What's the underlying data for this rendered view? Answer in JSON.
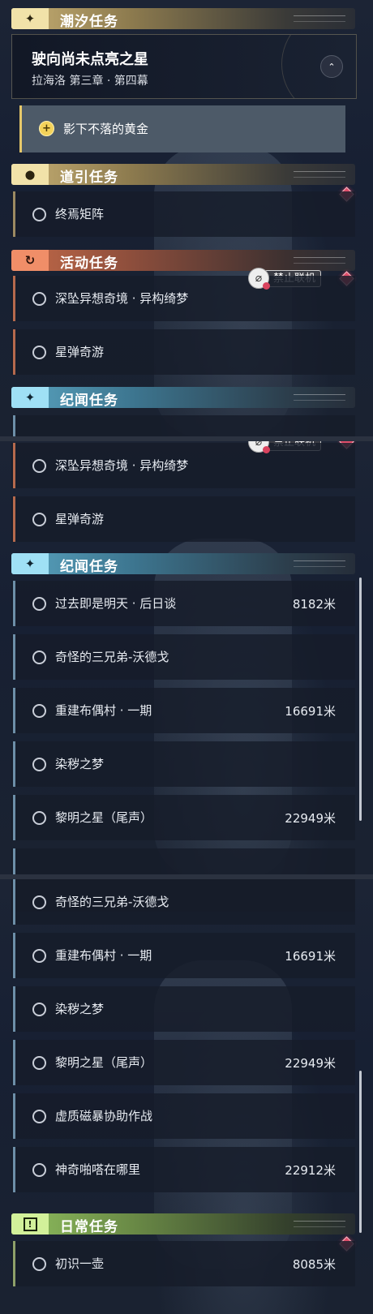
{
  "icons": {
    "tide": "✦",
    "guide": "⬤",
    "activity": "↻",
    "lore": "✦",
    "daily": "!",
    "main_pin": "⌃",
    "sub_quest": "+",
    "no_online": "⌀"
  },
  "tide_section": {
    "header": "潮汐任务",
    "main_quest_title": "驶向尚未点亮之星",
    "main_quest_chapter": "拉海洛 第三章 · 第四幕",
    "sub_quest": "影下不落的黄金"
  },
  "guide_section": {
    "header": "道引任务",
    "items": [
      "终焉矩阵"
    ]
  },
  "activity_section": {
    "header": "活动任务",
    "no_online_label": "禁止联机",
    "items": [
      "深坠异想奇境 · 异构绮梦",
      "星弹奇游"
    ]
  },
  "lore_section": {
    "header": "纪闻任务",
    "items": [
      {
        "name": "过去即是明天 · 后日谈",
        "distance": "8182米"
      },
      {
        "name": "奇怪的三兄弟-沃德戈",
        "distance": ""
      },
      {
        "name": "重建布偶村 · 一期",
        "distance": "16691米"
      },
      {
        "name": "染秽之梦",
        "distance": ""
      },
      {
        "name": "黎明之星（尾声）",
        "distance": "22949米"
      },
      {
        "name": "虚质磁暴协助作战",
        "distance": ""
      },
      {
        "name": "神奇啪嗒在哪里",
        "distance": "22912米"
      }
    ]
  },
  "daily_section": {
    "header": "日常任务",
    "items": [
      {
        "name": "初识一壶",
        "distance": "8085米"
      }
    ]
  },
  "colors": {
    "tide_accent": "#c8b074",
    "activity_accent": "#f08e68",
    "lore_accent": "#9fe0f5",
    "daily_accent": "#d2f19a",
    "alert_diamond": "#e04d6a"
  }
}
